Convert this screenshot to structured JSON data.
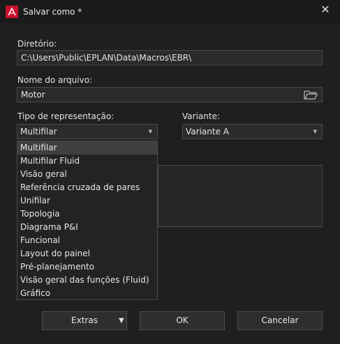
{
  "window": {
    "title": "Salvar como *"
  },
  "directory": {
    "label": "Diretório:",
    "value": "C:\\Users\\Public\\EPLAN\\Data\\Macros\\EBR\\"
  },
  "filename": {
    "label": "Nome do arquivo:",
    "value": "Motor"
  },
  "representation": {
    "label": "Tipo de representação:",
    "selected": "Multifilar",
    "options": [
      "Multifilar",
      "Multifilar Fluid",
      "Visão geral",
      "Referência cruzada de pares",
      "Unifilar",
      "Topologia",
      "Diagrama P&I",
      "Funcional",
      "Layout do painel",
      "Pré-planejamento",
      "Visão geral das funções (Fluid)",
      "Gráfico"
    ]
  },
  "variant": {
    "label": "Variante:",
    "selected": "Variante A"
  },
  "buttons": {
    "extras": "Extras",
    "ok": "OK",
    "cancel": "Cancelar"
  },
  "colors": {
    "accent": "#c8102e",
    "background": "#1f1f1f",
    "selection": "#3f3f3f"
  },
  "icons": {
    "app": "eplan-logo-icon",
    "close": "close-icon",
    "folder": "folder-open-icon",
    "dropdown": "chevron-down-icon"
  }
}
